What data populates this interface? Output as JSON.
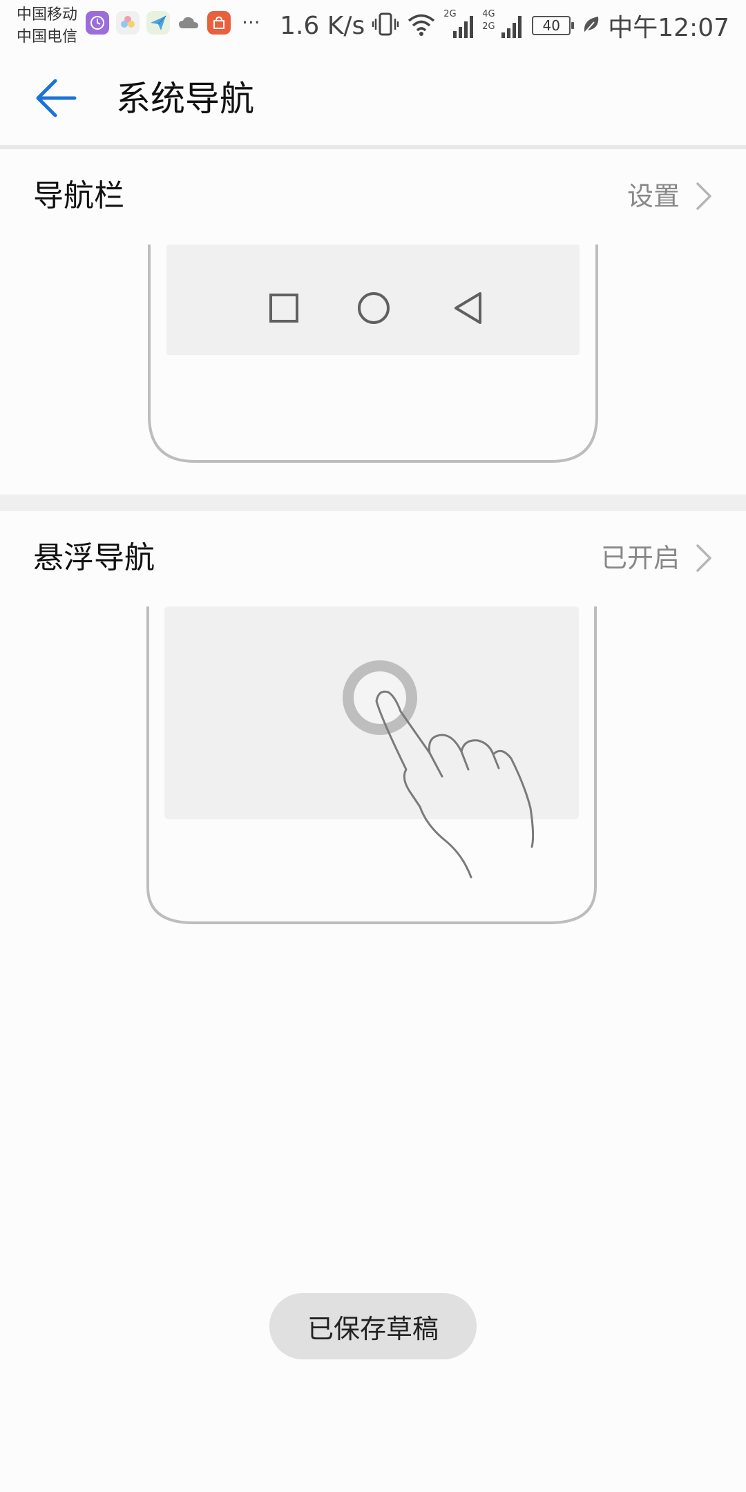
{
  "status_bar": {
    "carrier_1": "中国移动",
    "carrier_2": "中国电信",
    "notification_icons": [
      "clock-app-icon",
      "gallery-icon",
      "send-icon",
      "cloud-icon",
      "store-icon"
    ],
    "more": "···",
    "net_speed": "1.6 K/s",
    "network_1": "2G",
    "network_2_top": "4G",
    "network_2_bottom": "2G",
    "battery_level": "40",
    "clock": "中午12:07"
  },
  "app_bar": {
    "back_icon": "arrow-left-icon",
    "title": "系统导航",
    "accent_color": "#1a73d9"
  },
  "sections": {
    "navigation_bar": {
      "title": "导航栏",
      "value": "设置",
      "illustration_buttons": [
        "recent-apps-square-icon",
        "home-circle-icon",
        "back-triangle-icon"
      ]
    },
    "floating_nav": {
      "title": "悬浮导航",
      "value": "已开启",
      "illustration": "floating-dock-with-finger"
    }
  },
  "toast": {
    "text": "已保存草稿"
  }
}
